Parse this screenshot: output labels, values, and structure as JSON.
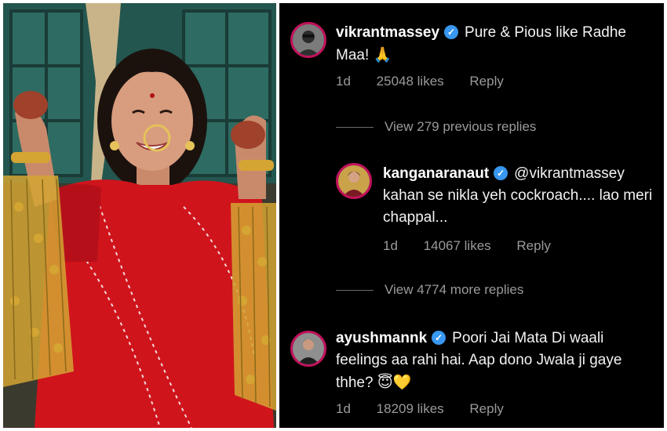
{
  "comments": {
    "top": {
      "username": "vikrantmassey",
      "text": "Pure & Pious like Radhe Maa!",
      "emoji": "🙏",
      "age": "1d",
      "likes": "25048 likes",
      "reply": "Reply"
    },
    "view_previous": "View 279 previous replies",
    "reply": {
      "username": "kanganaranaut",
      "mention": "@vikrantmassey",
      "text": "kahan se nikla yeh cockroach.... lao meri chappal...",
      "age": "1d",
      "likes": "14067 likes",
      "reply": "Reply"
    },
    "view_more": "View 4774 more replies",
    "bottom": {
      "username": "ayushmannk",
      "text": "Poori Jai Mata Di waali feelings aa rahi hai. Aap dono Jwala ji gaye thhe?",
      "emoji": "😇💛",
      "age": "1d",
      "likes": "18209 likes",
      "reply": "Reply"
    }
  },
  "colors": {
    "panel_bg": "#000000",
    "avatar_ring": "#c1125b",
    "verified_badge": "#3897f0",
    "muted_text": "#9a9a9a",
    "saree_red": "#d0141c",
    "gold": "#d4a532"
  }
}
